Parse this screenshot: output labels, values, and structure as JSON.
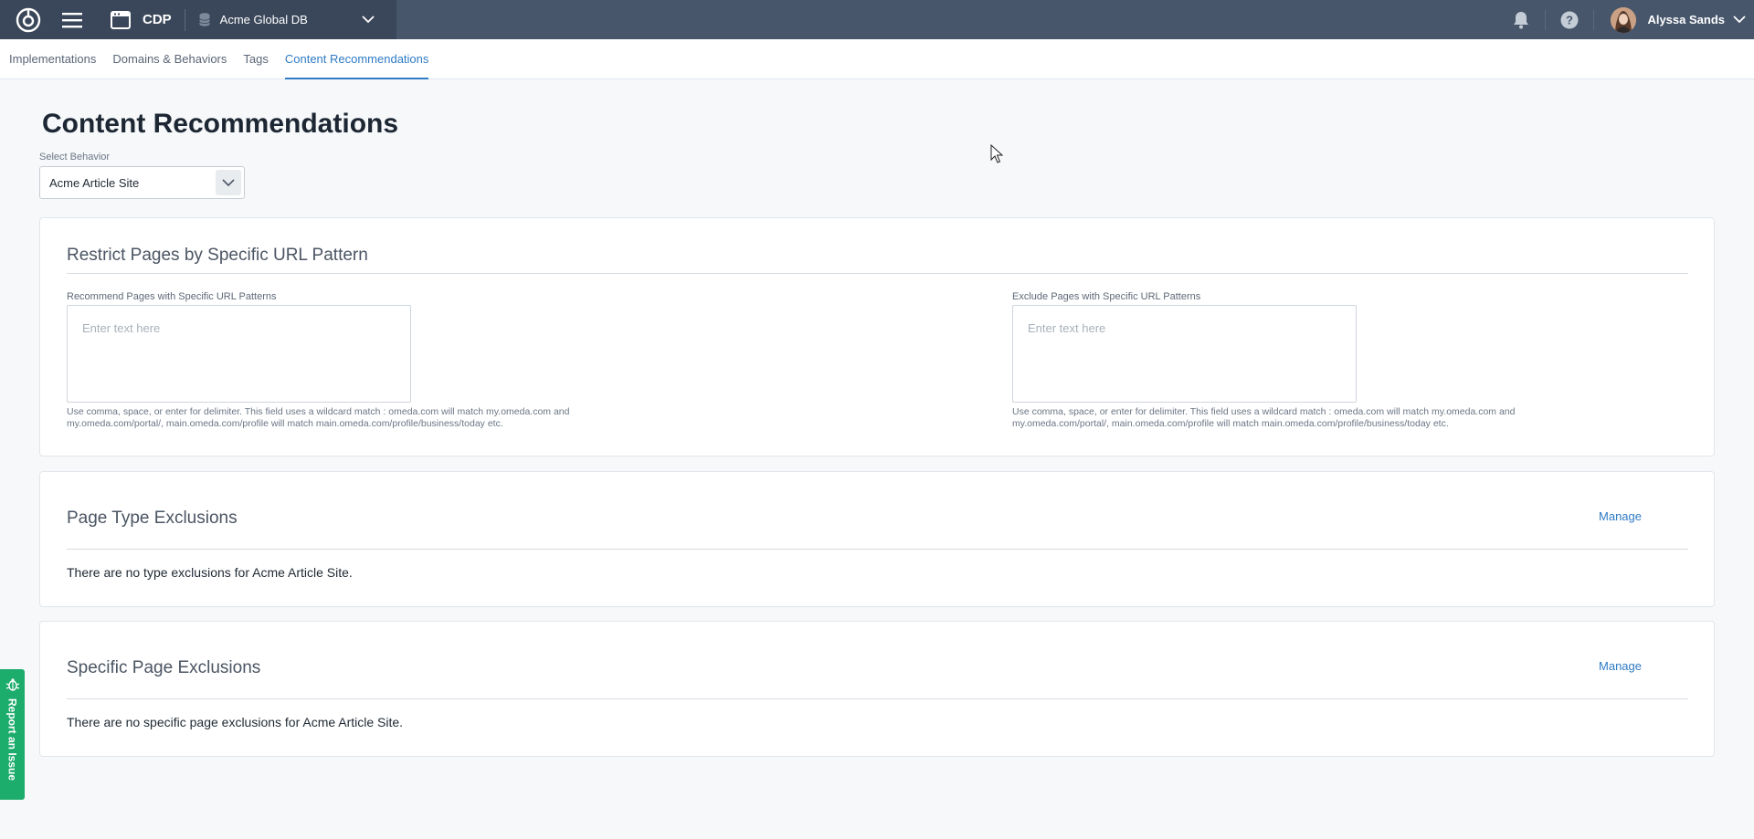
{
  "topbar": {
    "app_name": "CDP",
    "database": "Acme Global DB",
    "user_name": "Alyssa Sands",
    "icons": [
      "app-logo-icon",
      "hamburger-menu-icon",
      "app-window-icon",
      "database-icon",
      "chevron-down-icon",
      "bell-icon",
      "help-icon",
      "avatar",
      "chevron-down-icon"
    ]
  },
  "subnav": {
    "tabs": [
      {
        "label": "Implementations",
        "active": false
      },
      {
        "label": "Domains & Behaviors",
        "active": false
      },
      {
        "label": "Tags",
        "active": false
      },
      {
        "label": "Content Recommendations",
        "active": true
      }
    ]
  },
  "page": {
    "title": "Content Recommendations",
    "select_label": "Select Behavior",
    "select_value": "Acme Article Site"
  },
  "url_card": {
    "title": "Restrict Pages by Specific URL Pattern",
    "recommend": {
      "label": "Recommend Pages with Specific URL Patterns",
      "placeholder": "Enter text here",
      "help_line1": "Use comma, space, or enter for delimiter. This field uses a wildcard match : omeda.com will match my.omeda.com and",
      "help_line2": "my.omeda.com/portal/, main.omeda.com/profile will match main.omeda.com/profile/business/today etc."
    },
    "exclude": {
      "label": "Exclude Pages with Specific URL Patterns",
      "placeholder": "Enter text here",
      "help_line1": "Use comma, space, or enter for delimiter. This field uses a wildcard match : omeda.com will match my.omeda.com and",
      "help_line2": "my.omeda.com/portal/, main.omeda.com/profile will match main.omeda.com/profile/business/today etc."
    }
  },
  "type_card": {
    "title": "Page Type Exclusions",
    "manage_label": "Manage",
    "empty_message": "There are no type exclusions for Acme Article Site."
  },
  "page_card": {
    "title": "Specific Page Exclusions",
    "manage_label": "Manage",
    "empty_message": "There are no specific page exclusions for Acme Article Site."
  },
  "report": {
    "label": "Report an Issue"
  },
  "colors": {
    "topbar": "#47566b",
    "topbar_left": "#3a475a",
    "accent": "#2f7bc4",
    "report_green": "#1cac6c"
  }
}
